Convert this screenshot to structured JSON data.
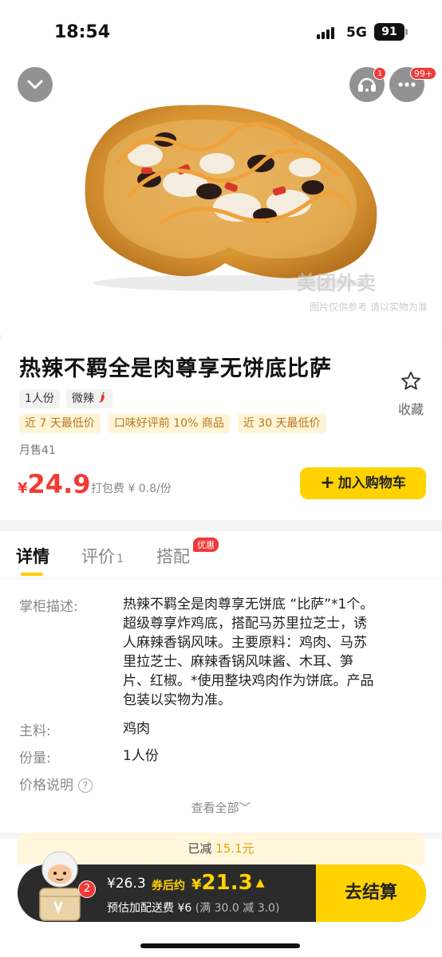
{
  "status": {
    "time": "18:54",
    "network": "5G",
    "battery": "91"
  },
  "header": {
    "back_icon": "chevron-down-icon",
    "service_icon": "customer-service-icon",
    "service_badge": "1",
    "more_icon": "ellipsis-icon",
    "more_badge": "99+"
  },
  "hero": {
    "watermark": "美团外卖",
    "watermark_note": "图片仅供参考 请以实物为准"
  },
  "product": {
    "name": "热辣不羁全是肉尊享无饼底比萨",
    "favorite_label": "收藏",
    "specs": [
      "1人份",
      "微辣"
    ],
    "tags": [
      "近 7 天最低价",
      "口味好评前 10% 商品",
      "近 30 天最低价"
    ],
    "monthly_sales": "月售41",
    "currency": "¥",
    "price": "24.9",
    "packing_fee": "打包费 ¥ 0.8/份",
    "add_to_cart": "加入购物车"
  },
  "tabs": [
    {
      "label": "详情"
    },
    {
      "label": "评价",
      "count": "1"
    },
    {
      "label": "搭配",
      "badge": "优惠"
    }
  ],
  "details": {
    "desc_label": "掌柜描述:",
    "desc_lines": [
      "热辣不羁全是肉尊享无饼底 “比萨”*1个。",
      "超级尊享炸鸡底，搭配马苏里拉芝士，诱",
      "人麻辣香锅风味。主要原料：鸡肉、马苏",
      "里拉芝士、麻辣香锅风味酱、木耳、笋",
      "片、红椒。*使用整块鸡肉作为饼底。产品",
      "包装以实物为准。"
    ],
    "main_label": "主料:",
    "main_value": "鸡肉",
    "portion_label": "份量:",
    "portion_value": "1人份",
    "price_note_label": "价格说明",
    "see_all": "查看全部﹀"
  },
  "cart": {
    "discount_prefix": "已减",
    "discount_amount": "15.1元",
    "item_count": "2",
    "original_price": "¥26.3",
    "after_coupon_label": "券后约",
    "final_currency": "¥",
    "final_price": "21.3",
    "delivery": "预估加配送费 ¥6",
    "delivery_sub": "(满 30.0 减 3.0)",
    "checkout": "去结算"
  },
  "colors": {
    "accent_yellow": "#ffd200",
    "price_red": "#f23a30",
    "tag_bg": "#fff4d6"
  }
}
